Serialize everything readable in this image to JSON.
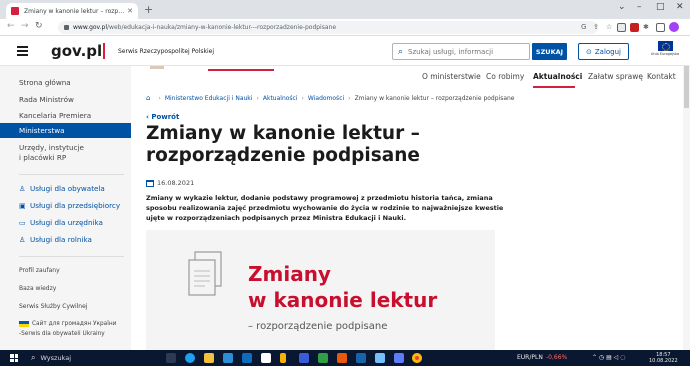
{
  "browser": {
    "tab_title": "Zmiany w kanonie lektur – rozp…",
    "new_tab": "+",
    "url_host": "www.gov.pl",
    "url_path": "/web/edukacja-i-nauka/zmiany-w-kanonie-lektur---rozporzadzenie-podpisane",
    "window_controls": [
      "⌄",
      "–",
      "□",
      "✕"
    ]
  },
  "header": {
    "logo": "gov.pl",
    "service": "Serwis Rzeczypospolitej Polskiej",
    "search_placeholder": "Szukaj usługi, informacji",
    "search_button": "SZUKAJ",
    "login_button": "Zaloguj",
    "eu_caption": "Unia Europejska"
  },
  "sidebar": {
    "items": [
      "Strona główna",
      "Rada Ministrów",
      "Kancelaria Premiera",
      "Ministerstwa",
      "Urzędy, instytucje",
      "i placówki RP"
    ],
    "services": [
      "Usługi dla obywatela",
      "Usługi dla przedsiębiorcy",
      "Usługi dla urzędnika",
      "Usługi dla rolnika"
    ],
    "bottom": [
      "Profil zaufany",
      "Baza wiedzy",
      "Serwis Służby Cywilnej",
      "Сайт для громадян України",
      "-Serwis dla obywateli Ukrainy"
    ]
  },
  "topnav": [
    "O ministerstwie",
    "Co robimy",
    "Aktualności",
    "Załatw sprawę",
    "Kontakt"
  ],
  "breadcrumb": [
    "Ministerstwo Edukacji i Nauki",
    "Aktualności",
    "Wiadomości",
    "Zmiany w kanonie lektur – rozporządzenie podpisane"
  ],
  "article": {
    "back": "Powrót",
    "title": "Zmiany w kanonie lektur – rozporządzenie podpisane",
    "date": "16.08.2021",
    "lead": "Zmiany w wykazie lektur, dodanie podstawy programowej z przedmiotu historia tańca, zmiana sposobu realizowania zajęć przedmiotu wychowanie do życia w rodzinie to najważniejsze kwestie ujęte w rozporządzeniach podpisanych przez Ministra Edukacji i Nauki.",
    "image": {
      "line1": "Zmiany",
      "line2": "w kanonie lektur",
      "sub": "– rozporządzenie podpisane"
    }
  },
  "taskbar": {
    "search_placeholder": "Wyszukaj",
    "ticker": "EUR/PLN",
    "ticker_change": "-0,66%",
    "time": "18:57",
    "date": "10.08.2022"
  }
}
